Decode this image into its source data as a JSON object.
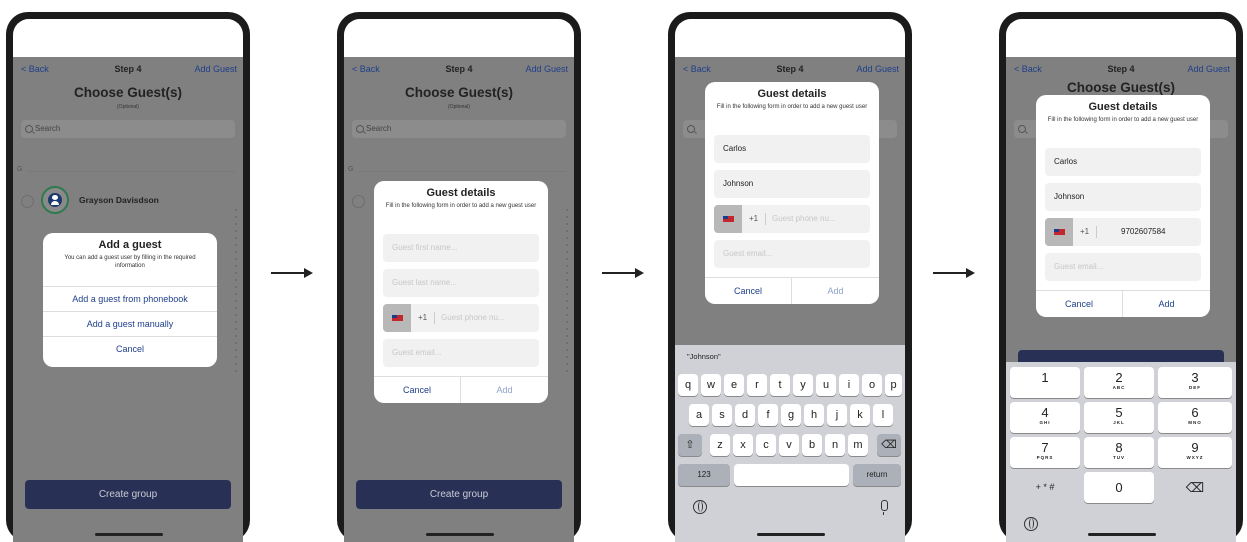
{
  "nav": {
    "back": "< Back",
    "title": "Step 4",
    "add_guest": "Add Guest"
  },
  "header": {
    "title": "Choose Guest(s)",
    "subtitle": "(Optional)"
  },
  "search": {
    "placeholder": "Search"
  },
  "list": {
    "section_letter": "G",
    "contact_name": "Grayson Davisdson"
  },
  "create_group": "Create group",
  "add_guest_sheet": {
    "title": "Add a guest",
    "description": "You can add a guest user by filling in the required information",
    "options": [
      "Add a guest from phonebook",
      "Add a guest manually",
      "Cancel"
    ]
  },
  "guest_form": {
    "title": "Guest details",
    "description": "Fill in the following form in order to add a new guest user",
    "first_name_placeholder": "Guest first name...",
    "last_name_placeholder": "Guest last name...",
    "phone_placeholder": "Guest phone nu...",
    "email_placeholder": "Guest email...",
    "country_code": "+1",
    "cancel": "Cancel",
    "add": "Add",
    "first_name_value": "Carlos",
    "last_name_value": "Johnson",
    "phone_value": "9702607584"
  },
  "keyboard": {
    "suggestion": "\"Johnson\"",
    "row1": [
      "q",
      "w",
      "e",
      "r",
      "t",
      "y",
      "u",
      "i",
      "o",
      "p"
    ],
    "row2": [
      "a",
      "s",
      "d",
      "f",
      "g",
      "h",
      "j",
      "k",
      "l"
    ],
    "row3": [
      "z",
      "x",
      "c",
      "v",
      "b",
      "n",
      "m"
    ],
    "numbers_key": "123",
    "return_key": "return",
    "shift_symbol": "⇧",
    "delete_symbol": "⌫"
  },
  "numpad": {
    "keys": [
      {
        "d": "1",
        "l": ""
      },
      {
        "d": "2",
        "l": "ABC"
      },
      {
        "d": "3",
        "l": "DEF"
      },
      {
        "d": "4",
        "l": "GHI"
      },
      {
        "d": "5",
        "l": "JKL"
      },
      {
        "d": "6",
        "l": "MNO"
      },
      {
        "d": "7",
        "l": "PQRS"
      },
      {
        "d": "8",
        "l": "TUV"
      },
      {
        "d": "9",
        "l": "WXYZ"
      }
    ],
    "symbols": "+ * #",
    "zero": "0",
    "delete_symbol": "⌫"
  },
  "colors": {
    "navy_button": "#283056",
    "link_blue": "#1f3f8a",
    "dim_overlay": "#808080",
    "avatar_ring": "#2d7a4e"
  }
}
